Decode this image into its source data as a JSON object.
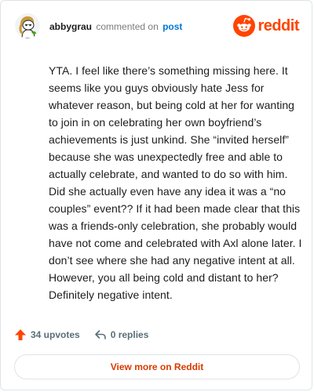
{
  "comment": {
    "author": "abbygrau",
    "commented_label": "commented on",
    "post_link_label": "post",
    "body": "YTA. I feel like there’s something missing here. It seems like you guys obviously hate Jess for whatever reason, but being cold at her for wanting to join in on celebrating her own boyfriend’s achievements is just unkind. She “invited herself” because she was unexpectedly free and able to actually celebrate, and wanted to do so with him. Did she actually even have any idea it was a “no couples” event?? If it had been made clear that this was a friends-only celebration, she probably would have not come and celebrated with Axl alone later. I don’t see where she had any negative intent at all. However, you all being cold and distant to her? Definitely negative intent.",
    "upvotes_label": "34 upvotes",
    "replies_label": "0 replies"
  },
  "brand": {
    "name": "reddit",
    "icon": "reddit-snoo-icon",
    "color": "#ff4500"
  },
  "footer": {
    "view_more_label": "View more on Reddit"
  },
  "icons": {
    "avatar": "avatar-snoo",
    "upvote": "upvote-arrow-icon",
    "reply": "reply-arrow-icon"
  },
  "colors": {
    "link": "#0079d3",
    "upvote": "#ff4500",
    "view_more": "#d93a00",
    "meta": "#7c7c7c"
  }
}
